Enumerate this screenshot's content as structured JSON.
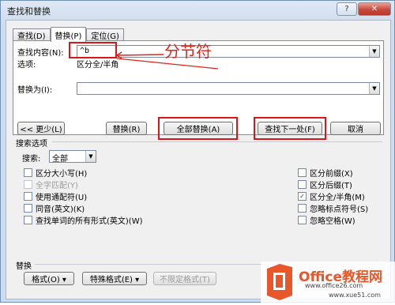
{
  "title": "查找和替换",
  "title_buttons": {
    "help": "?",
    "close": "✕"
  },
  "tabs": [
    {
      "label": "查找(D)",
      "active": false
    },
    {
      "label": "替换(P)",
      "active": true
    },
    {
      "label": "定位(G)",
      "active": false
    }
  ],
  "find": {
    "label": "查找内容(N):",
    "value": "^b",
    "options_label": "选项:",
    "options_value": "区分全/半角"
  },
  "replace": {
    "label": "替换为(I):",
    "value": ""
  },
  "annotation": "分节符",
  "buttons": {
    "less": "<< 更少(L)",
    "replace": "替换(R)",
    "replace_all": "全部替换(A)",
    "find_next": "查找下一处(F)",
    "cancel": "取消"
  },
  "search_options": {
    "heading": "搜索选项",
    "search_label": "搜索:",
    "search_value": "全部",
    "left": [
      {
        "label": "区分大小写(H)",
        "checked": false,
        "disabled": false
      },
      {
        "label": "全字匹配(Y)",
        "checked": false,
        "disabled": true
      },
      {
        "label": "使用通配符(U)",
        "checked": false,
        "disabled": false
      },
      {
        "label": "同音(英文)(K)",
        "checked": false,
        "disabled": false
      },
      {
        "label": "查找单词的所有形式(英文)(W)",
        "checked": false,
        "disabled": false
      }
    ],
    "right": [
      {
        "label": "区分前缀(X)",
        "checked": false
      },
      {
        "label": "区分后缀(T)",
        "checked": false
      },
      {
        "label": "区分全/半角(M)",
        "checked": true
      },
      {
        "label": "忽略标点符号(S)",
        "checked": false
      },
      {
        "label": "忽略空格(W)",
        "checked": false
      }
    ]
  },
  "replace_section": {
    "heading": "替换",
    "format": "格式(O) ▾",
    "special": "特殊格式(E) ▾",
    "no_format": "不限定格式(T)"
  },
  "watermark": {
    "brand": "Office教程网",
    "url": "www.office26.com",
    "site": "www.xue51.com"
  },
  "colors": {
    "annotation_red": "#e2231a",
    "logo_orange": "#e8572a"
  }
}
